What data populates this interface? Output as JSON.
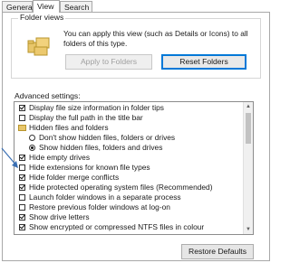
{
  "tabs": [
    {
      "label": "General",
      "active": false
    },
    {
      "label": "View",
      "active": true
    },
    {
      "label": "Search",
      "active": false
    }
  ],
  "folder_views": {
    "title": "Folder views",
    "description": "You can apply this view (such as Details or Icons) to all folders of this type.",
    "apply_label": "Apply to Folders",
    "reset_label": "Reset Folders"
  },
  "advanced": {
    "title": "Advanced settings:",
    "items": [
      {
        "kind": "checkbox",
        "label": "Display file size information in folder tips",
        "checked": true,
        "indent": 0
      },
      {
        "kind": "checkbox",
        "label": "Display the full path in the title bar",
        "checked": false,
        "indent": 0
      },
      {
        "kind": "folder",
        "label": "Hidden files and folders",
        "indent": 0
      },
      {
        "kind": "radio",
        "label": "Don't show hidden files, folders or drives",
        "selected": false,
        "indent": 1
      },
      {
        "kind": "radio",
        "label": "Show hidden files, folders and drives",
        "selected": true,
        "indent": 1
      },
      {
        "kind": "checkbox",
        "label": "Hide empty drives",
        "checked": true,
        "indent": 0
      },
      {
        "kind": "checkbox",
        "label": "Hide extensions for known file types",
        "checked": false,
        "indent": 0
      },
      {
        "kind": "checkbox",
        "label": "Hide folder merge conflicts",
        "checked": true,
        "indent": 0
      },
      {
        "kind": "checkbox",
        "label": "Hide protected operating system files (Recommended)",
        "checked": true,
        "indent": 0
      },
      {
        "kind": "checkbox",
        "label": "Launch folder windows in a separate process",
        "checked": false,
        "indent": 0
      },
      {
        "kind": "checkbox",
        "label": "Restore previous folder windows at log-on",
        "checked": false,
        "indent": 0
      },
      {
        "kind": "checkbox",
        "label": "Show drive letters",
        "checked": true,
        "indent": 0
      },
      {
        "kind": "checkbox",
        "label": "Show encrypted or compressed NTFS files in colour",
        "checked": true,
        "indent": 0
      }
    ]
  },
  "restore_defaults_label": "Restore Defaults",
  "colors": {
    "accent": "#0078d7",
    "arrow": "#3a6fb3"
  }
}
